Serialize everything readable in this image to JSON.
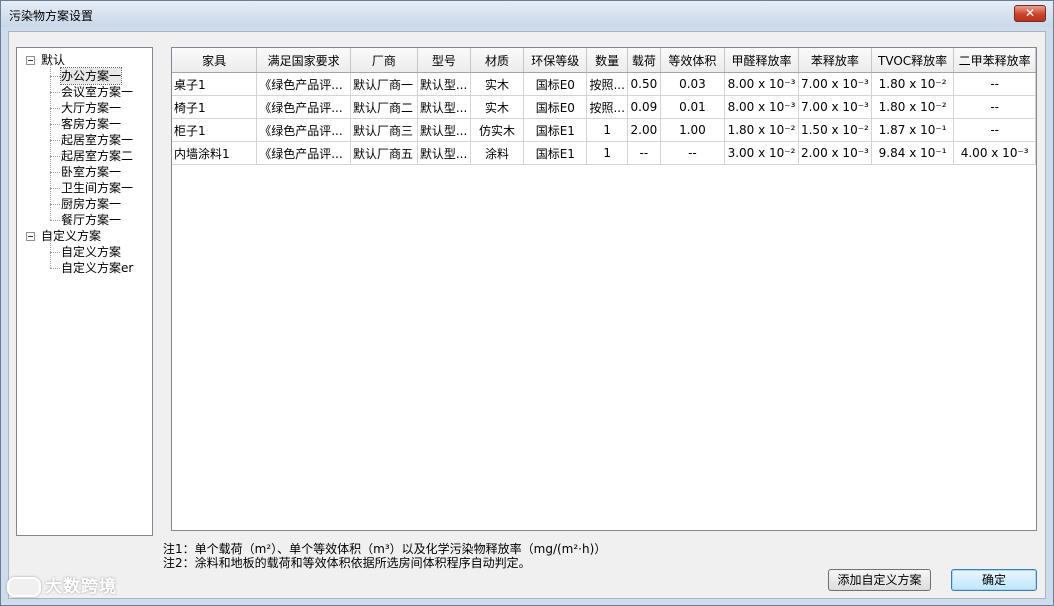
{
  "window": {
    "title": "污染物方案设置",
    "close_glyph": "✕"
  },
  "tree": {
    "groups": [
      {
        "label": "默认",
        "items": [
          "办公方案一",
          "会议室方案一",
          "大厅方案一",
          "客房方案一",
          "起居室方案一",
          "起居室方案二",
          "卧室方案一",
          "卫生间方案一",
          "厨房方案一",
          "餐厅方案一"
        ]
      },
      {
        "label": "自定义方案",
        "items": [
          "自定义方案",
          "自定义方案er"
        ]
      }
    ]
  },
  "table": {
    "columns": [
      "家具",
      "满足国家要求",
      "厂商",
      "型号",
      "材质",
      "环保等级",
      "数量",
      "载荷",
      "等效体积",
      "甲醛释放率",
      "苯释放率",
      "TVOC释放率",
      "二甲苯释放率"
    ],
    "rows": [
      [
        "桌子1",
        "《绿色产品评...",
        "默认厂商一",
        "默认型...",
        "实木",
        "国标E0",
        "按照...",
        "0.50",
        "0.03",
        "8.00 x 10⁻³",
        "7.00 x 10⁻³",
        "1.80 x 10⁻²",
        "--"
      ],
      [
        "椅子1",
        "《绿色产品评...",
        "默认厂商二",
        "默认型...",
        "实木",
        "国标E0",
        "按照...",
        "0.09",
        "0.01",
        "8.00 x 10⁻³",
        "7.00 x 10⁻³",
        "1.80 x 10⁻²",
        "--"
      ],
      [
        "柜子1",
        "《绿色产品评...",
        "默认厂商三",
        "默认型...",
        "仿实木",
        "国标E1",
        "1",
        "2.00",
        "1.00",
        "1.80 x 10⁻²",
        "1.50 x 10⁻²",
        "1.87 x 10⁻¹",
        "--"
      ],
      [
        "内墙涂料1",
        "《绿色产品评...",
        "默认厂商五",
        "默认型...",
        "涂料",
        "国标E1",
        "1",
        "--",
        "--",
        "3.00 x 10⁻²",
        "2.00 x 10⁻³",
        "9.84 x 10⁻¹",
        "4.00 x 10⁻³"
      ]
    ]
  },
  "notes": {
    "line1": "注1：单个载荷（m²）、单个等效体积（m³）以及化学污染物释放率（mg/(m²·h)）",
    "line2": "注2：涂料和地板的载荷和等效体积依据所选房间体积程序自动判定。"
  },
  "buttons": {
    "add_custom": "添加自定义方案",
    "ok": "确定"
  },
  "watermark": "大数跨境"
}
